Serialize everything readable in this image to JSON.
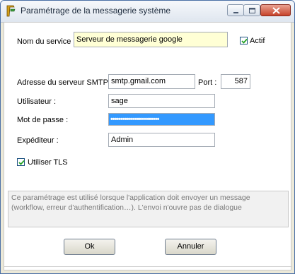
{
  "window": {
    "title": "Paramétrage de la messagerie système",
    "icons": {
      "app": "app-logo-icon",
      "minimize": "minimize-icon",
      "maximize": "maximize-icon",
      "close": "close-icon"
    }
  },
  "form": {
    "service_label": "Nom du service :",
    "service_value": "Serveur de messagerie google",
    "active_label": "Actif",
    "active_checked": true,
    "smtp_label": "Adresse du serveur SMTP :",
    "smtp_value": "smtp.gmail.com",
    "port_label": "Port :",
    "port_value": "587",
    "user_label": "Utilisateur :",
    "user_value": "sage",
    "password_label": "Mot de passe :",
    "password_value": "••••••••••••••••••••••••",
    "sender_label": "Expéditeur :",
    "sender_value": "Admin",
    "tls_label": "Utiliser TLS",
    "tls_checked": true
  },
  "info_text": "Ce paramétrage est utilisé lorsque l'application doit envoyer un message (workflow, erreur d'authentification…). L'envoi n'ouvre pas de dialogue",
  "buttons": {
    "ok": "Ok",
    "cancel": "Annuler"
  }
}
